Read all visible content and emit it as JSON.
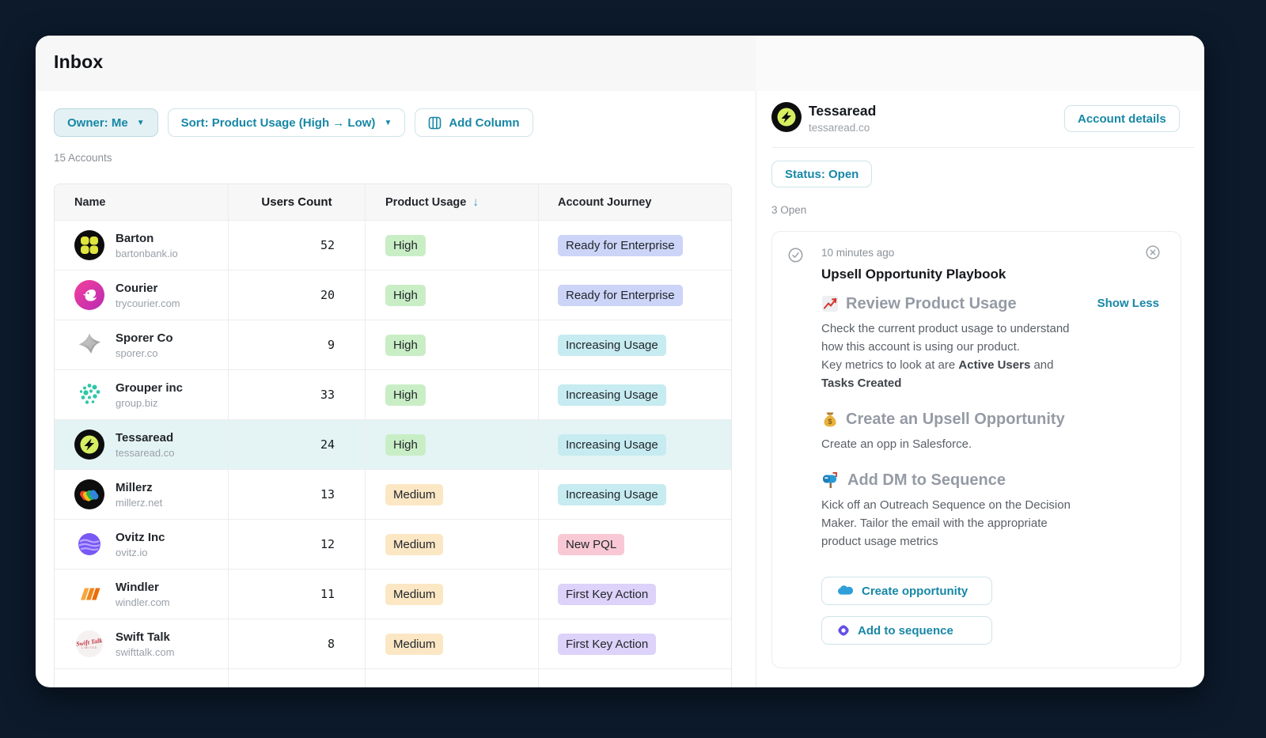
{
  "window_title": "Inbox",
  "toolbar": {
    "owner_label": "Owner: Me",
    "sort_label": "Sort: Product Usage (High → Low)",
    "add_column_label": "Add Column"
  },
  "accounts_count": "15 Accounts",
  "table": {
    "columns": [
      "Name",
      "Users Count",
      "Product Usage",
      "Account Journey"
    ],
    "sorted_column": "Product Usage",
    "sort_direction": "descending",
    "rows": [
      {
        "logo": "barton-logo",
        "name": "Barton",
        "domain": "bartonbank.io",
        "users": "52",
        "usage": "High",
        "journey": "Ready for Enterprise",
        "selected": false
      },
      {
        "logo": "courier-logo",
        "name": "Courier",
        "domain": "trycourier.com",
        "users": "20",
        "usage": "High",
        "journey": "Ready for Enterprise",
        "selected": false
      },
      {
        "logo": "sporer-logo",
        "name": "Sporer Co",
        "domain": "sporer.co",
        "users": "9",
        "usage": "High",
        "journey": "Increasing Usage",
        "selected": false
      },
      {
        "logo": "grouper-logo",
        "name": "Grouper inc",
        "domain": "group.biz",
        "users": "33",
        "usage": "High",
        "journey": "Increasing Usage",
        "selected": false
      },
      {
        "logo": "tessaread-logo",
        "name": "Tessaread",
        "domain": "tessaread.co",
        "users": "24",
        "usage": "High",
        "journey": "Increasing Usage",
        "selected": true
      },
      {
        "logo": "millerz-logo",
        "name": "Millerz",
        "domain": "millerz.net",
        "users": "13",
        "usage": "Medium",
        "journey": "Increasing Usage",
        "selected": false
      },
      {
        "logo": "ovitz-logo",
        "name": "Ovitz Inc",
        "domain": "ovitz.io",
        "users": "12",
        "usage": "Medium",
        "journey": "New PQL",
        "selected": false
      },
      {
        "logo": "windler-logo",
        "name": "Windler",
        "domain": "windler.com",
        "users": "11",
        "usage": "Medium",
        "journey": "First Key Action",
        "selected": false
      },
      {
        "logo": "swifttalk-logo",
        "name": "Swift Talk",
        "domain": "swifttalk.com",
        "users": "8",
        "usage": "Medium",
        "journey": "First Key Action",
        "selected": false
      }
    ]
  },
  "panel": {
    "account_name": "Tessaread",
    "account_domain": "tessaread.co",
    "account_details_label": "Account details",
    "status_label": "Status: Open",
    "open_count": "3 Open",
    "card": {
      "timestamp": "10 minutes ago",
      "title": "Upsell Opportunity Playbook",
      "show_less": "Show Less",
      "step1_heading": "Review Product Usage",
      "step1_body": "Check the current product usage to understand how this account is using our product.",
      "step1_metrics_prefix": "Key metrics to look at are ",
      "step1_metric_1": "Active Users",
      "step1_and": " and ",
      "step1_metric_2": "Tasks Created",
      "step2_heading": "Create an Upsell Opportunity",
      "step2_body": "Create an opp in Salesforce.",
      "step3_heading": "Add DM to Sequence",
      "step3_body": "Kick off an Outreach Sequence on the Decision Maker. Tailor the email with the appropriate product usage metrics",
      "action_create": "Create opportunity",
      "action_sequence": "Add to sequence"
    }
  },
  "icons": {
    "add_column": "table-columns-icon",
    "sort_indicator": "down-arrow-icon",
    "card_status": "check-circle-icon",
    "card_dismiss": "close-circle-icon",
    "step1": "chart-increasing-emoji",
    "step2": "money-bag-emoji",
    "step3": "mailbox-emoji",
    "action_create": "salesforce-cloud-icon",
    "action_sequence": "outreach-badge-icon"
  },
  "colors": {
    "accent_teal": "#1787a6",
    "page_background": "#0c1a2b",
    "selected_row_bg": "#e4f4f4",
    "badge_high": "#c9eec6",
    "badge_medium": "#fbe7c4",
    "badge_ready_for_enterprise": "#ccd4f8",
    "badge_increasing_usage": "#c6ebf0",
    "badge_new_pql": "#f8c9d4",
    "badge_first_key_action": "#ddd2f9"
  }
}
